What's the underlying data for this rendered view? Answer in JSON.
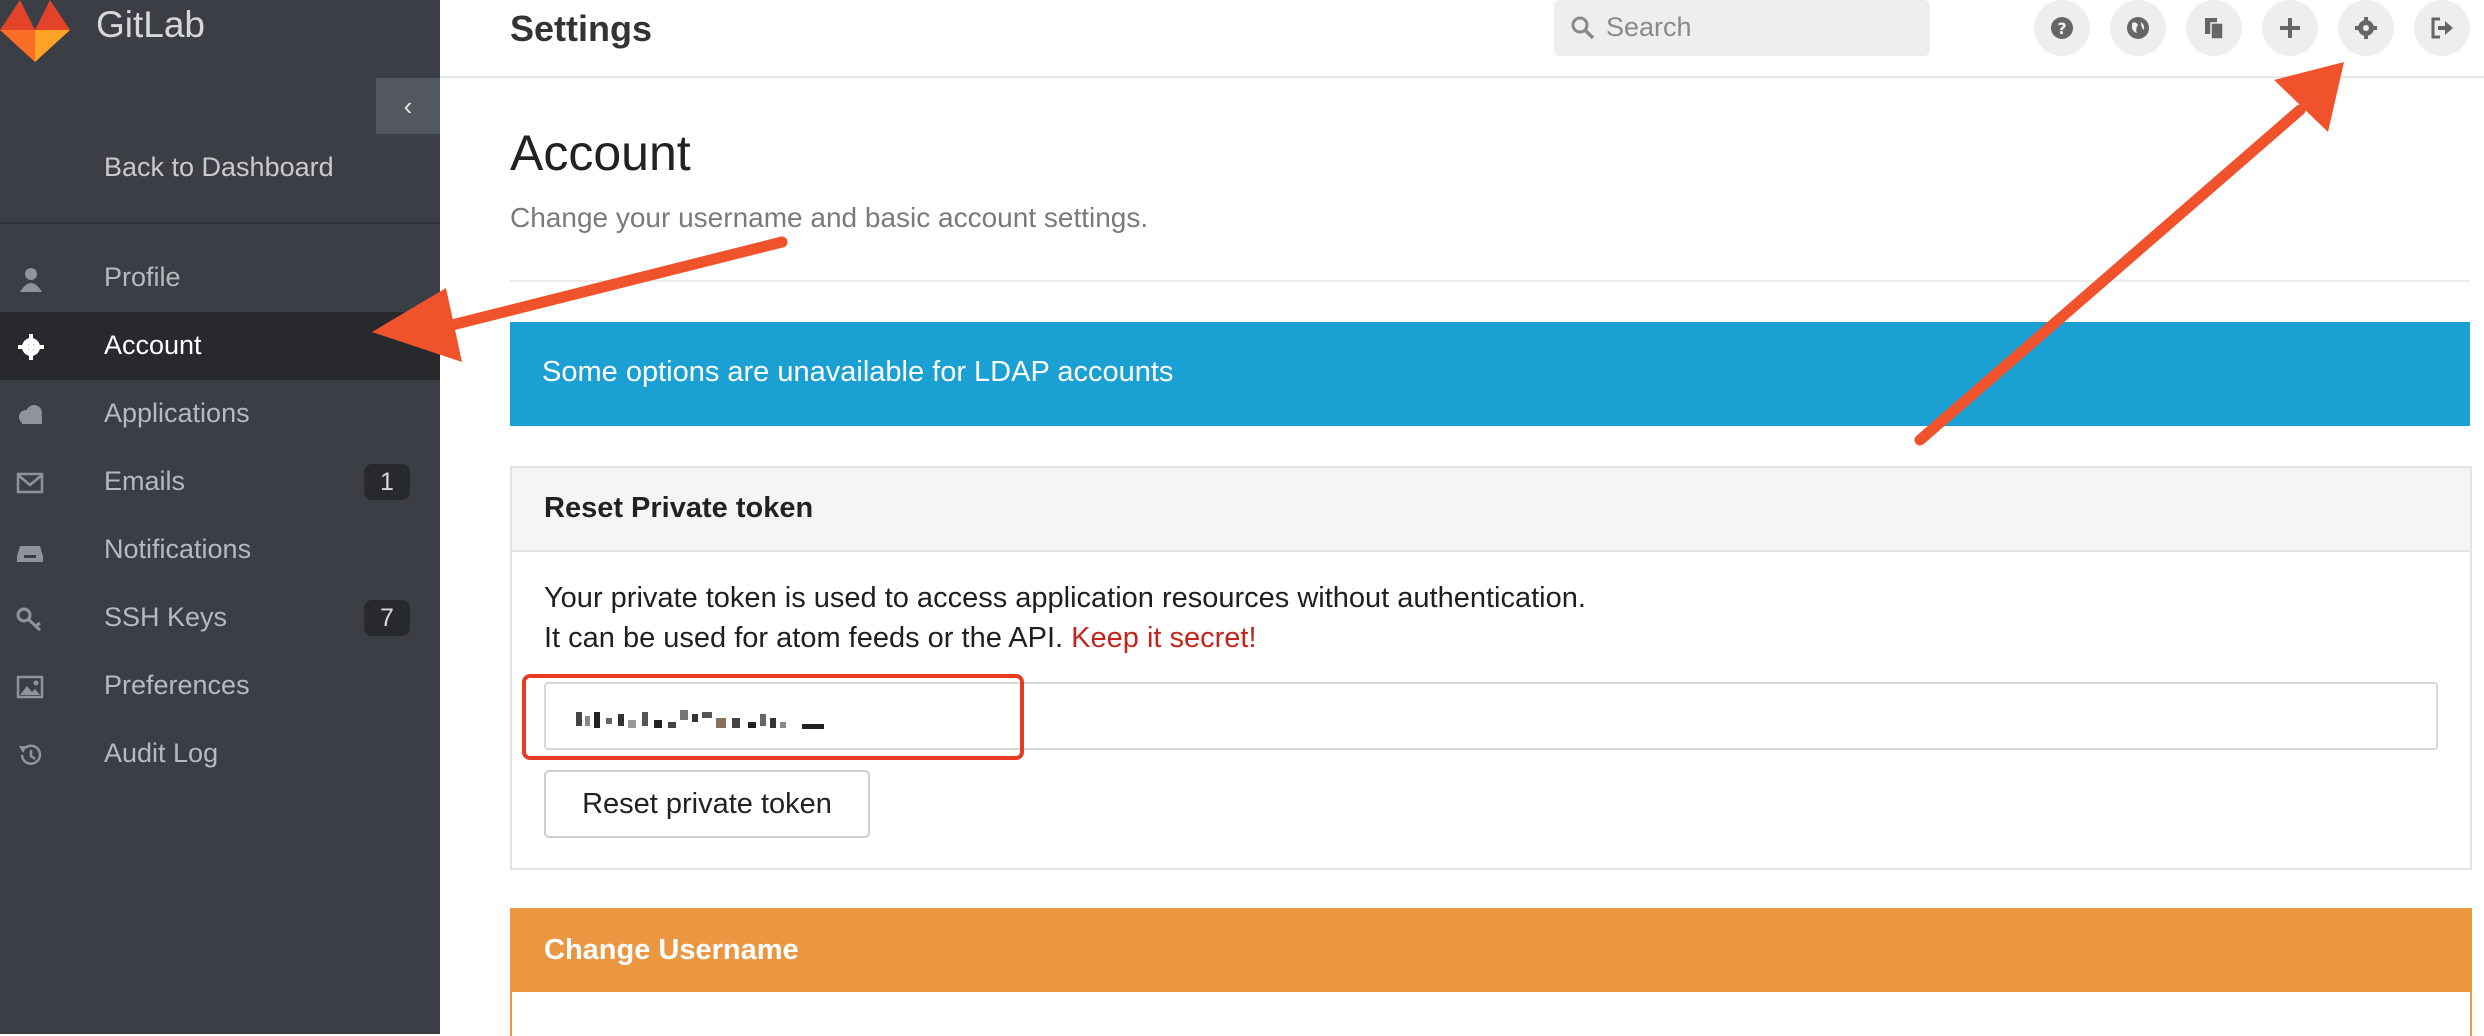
{
  "sidebar": {
    "brand": "GitLab",
    "collapse_glyph": "‹",
    "back_label": "Back to Dashboard",
    "items": [
      {
        "label": "Profile",
        "icon": "user-icon"
      },
      {
        "label": "Account",
        "icon": "gear-icon",
        "active": true
      },
      {
        "label": "Applications",
        "icon": "cloud-icon"
      },
      {
        "label": "Emails",
        "icon": "envelope-icon",
        "badge": "1"
      },
      {
        "label": "Notifications",
        "icon": "inbox-icon"
      },
      {
        "label": "SSH Keys",
        "icon": "key-icon",
        "badge": "7"
      },
      {
        "label": "Preferences",
        "icon": "image-icon"
      },
      {
        "label": "Audit Log",
        "icon": "history-icon"
      }
    ]
  },
  "header": {
    "title": "Settings",
    "search_placeholder": "Search",
    "buttons": [
      "help-icon",
      "globe-icon",
      "copy-icon",
      "plus-icon",
      "gear-icon",
      "sign-out-icon"
    ]
  },
  "main": {
    "heading": "Account",
    "lead": "Change your username and basic account settings.",
    "alert": "Some options are unavailable for LDAP accounts",
    "token_panel": {
      "title": "Reset Private token",
      "line1": "Your private token is used to access application resources without authentication.",
      "line2": "It can be used for atom feeds or the API.",
      "secret": "Keep it secret!",
      "button": "Reset private token"
    },
    "username_panel": {
      "title": "Change Username"
    }
  },
  "colors": {
    "sidebar_bg": "#3b3f45",
    "alert_bg": "#1aa0d3",
    "warning_bg": "#eb9641",
    "annotation": "#f0532b",
    "secret_text": "#c4261d"
  }
}
